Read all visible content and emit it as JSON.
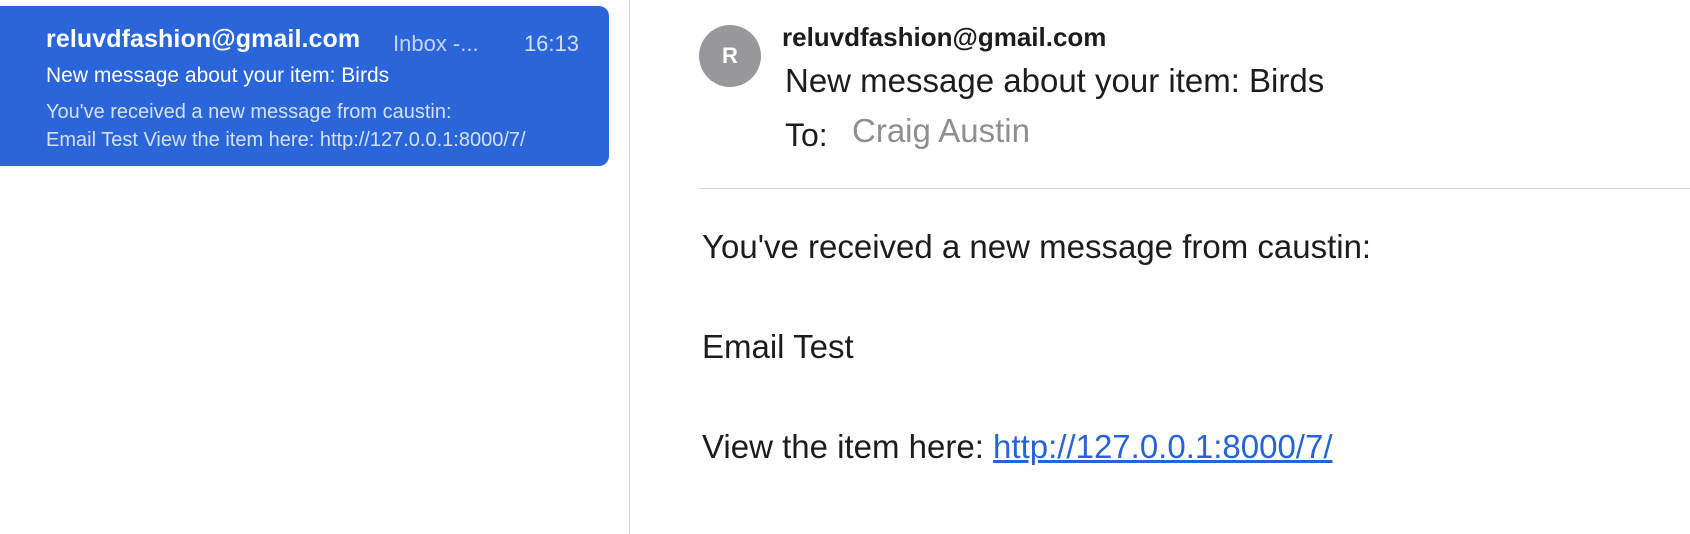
{
  "colors": {
    "selection_blue": "#2a66d9",
    "link_blue": "#2563d6",
    "avatar_gray": "#97979c"
  },
  "message_list": {
    "items": [
      {
        "sender": "reluvdfashion@gmail.com",
        "mailbox": "Inbox -...",
        "time": "16:13",
        "subject": "New message about your item: Birds",
        "preview_line_1": "You've received a new message from caustin:",
        "preview_line_2": "Email Test View the item here: http://127.0.0.1:8000/7/",
        "selected": true
      }
    ]
  },
  "message": {
    "avatar_initial": "R",
    "from": "reluvdfashion@gmail.com",
    "subject": "New message about your item: Birds",
    "to_label": "To:",
    "to_value": "Craig Austin",
    "body": {
      "line_1": "You've received a new message from caustin:",
      "line_2": "Email Test",
      "line_3_prefix": "View the item here: ",
      "link_text": "http://127.0.0.1:8000/7/"
    }
  }
}
